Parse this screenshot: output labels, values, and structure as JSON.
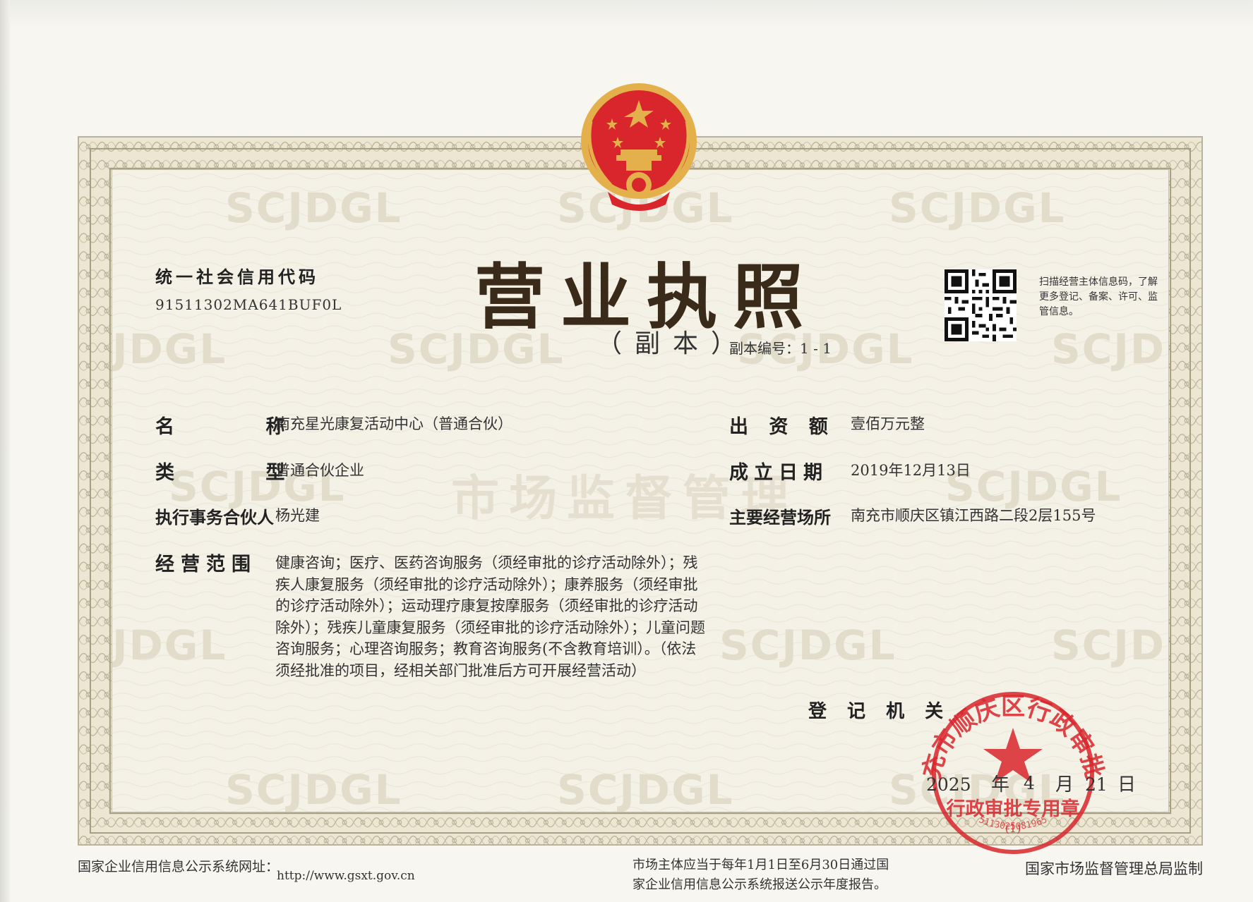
{
  "header": {
    "credit_code_label": "统一社会信用代码",
    "credit_code": "91511302MA641BUF0L",
    "title": "营业执照",
    "subtitle": "（副本）",
    "copy_number": "副本编号：1 - 1",
    "qr_note": "扫描经营主体信息码，了解更多登记、备案、许可、监管信息。"
  },
  "watermarks": {
    "latin": "SCJDGL",
    "latin_partial": "JDGL",
    "latin_right": "SCJD",
    "chinese": "市场监督管理"
  },
  "fields": {
    "name_label": "名 称",
    "name_value": "南充星光康复活动中心（普通合伙）",
    "type_label": "类 型",
    "type_value": "普通合伙企业",
    "partner_label": "执行事务合伙人",
    "partner_value": "杨光建",
    "capital_label": "出 资 额",
    "capital_value": "壹佰万元整",
    "date_label": "成立日期",
    "date_value": "2019年12月13日",
    "place_label": "主要经营场所",
    "place_value": "南充市顺庆区镇江西路二段2层155号",
    "scope_label": "经营范围",
    "scope_value": "健康咨询；医疗、医药咨询服务（须经审批的诊疗活动除外）；残疾人康复服务（须经审批的诊疗活动除外）；康养服务（须经审批的诊疗活动除外）；运动理疗康复按摩服务（须经审批的诊疗活动除外）；残疾儿童康复服务（须经审批的诊疗活动除外）；儿童问题咨询服务；心理咨询服务；教育咨询服务(不含教育培训）。（依法须经批准的项目，经相关部门批准后方可开展经营活动）"
  },
  "registration": {
    "authority_label": "登 记 机 关",
    "year": "2025",
    "year_unit": "年",
    "month": "4",
    "month_unit": "月",
    "day": "21",
    "day_unit": "日"
  },
  "seal": {
    "text_arc": "南充市顺庆区行政审批局",
    "text_inner": "行政审批专用章",
    "text_small": "(1)",
    "code": "5113025081965",
    "color": "#d8262c"
  },
  "emblem": {
    "color": "#d8262c",
    "gold": "#e3b04b"
  },
  "footer": {
    "system_label": "国家企业信用信息公示系统网址：",
    "url": "http://www.gsxt.gov.cn",
    "notice": "市场主体应当于每年1月1日至6月30日通过国家企业信用信息公示系统报送公示年度报告。",
    "supervisor": "国家市场监督管理总局监制"
  }
}
